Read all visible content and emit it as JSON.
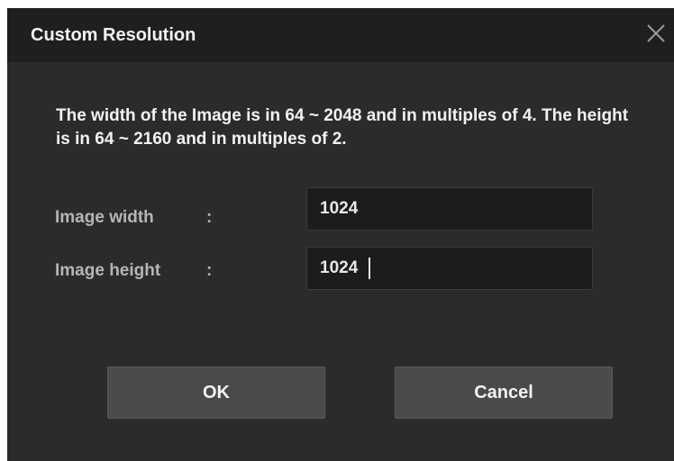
{
  "dialog": {
    "title": "Custom Resolution",
    "close_icon": "close-icon",
    "message": "The width of the Image is in 64 ~ 2048 and in multiples of 4. The height is in 64 ~ 2160 and in multiples of 2.",
    "fields": {
      "width": {
        "label": "Image width",
        "colon": ":",
        "value": "1024"
      },
      "height": {
        "label": "Image height",
        "colon": ":",
        "value": "1024"
      }
    },
    "buttons": {
      "ok": "OK",
      "cancel": "Cancel"
    }
  },
  "colors": {
    "background": "#2b2b2b",
    "titlebar": "#1f1f1f",
    "input_bg": "#1c1c1c",
    "button_bg": "#4a4a4a",
    "label_text": "#b5b5b5",
    "primary_text": "#f2f2f2"
  }
}
